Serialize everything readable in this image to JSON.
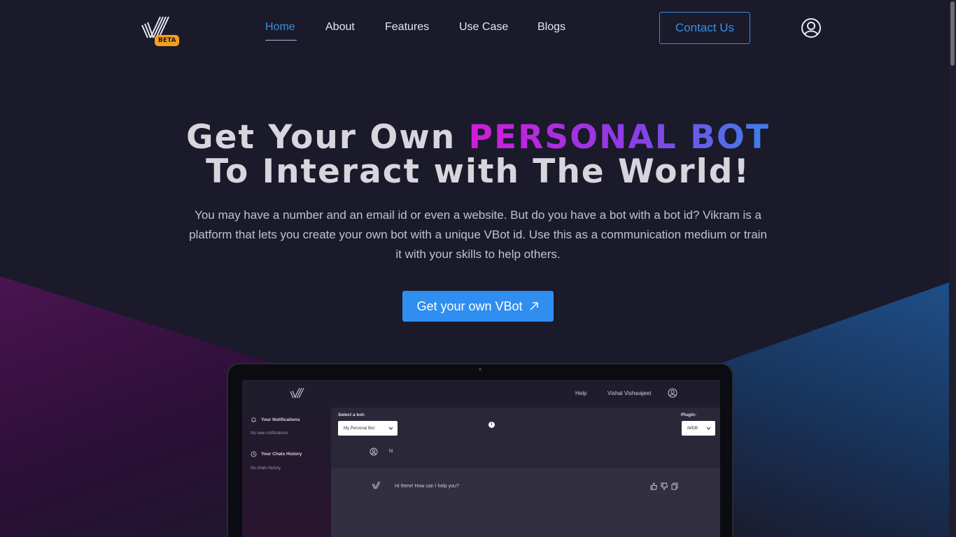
{
  "nav": {
    "beta": "BETA",
    "links": [
      "Home",
      "About",
      "Features",
      "Use Case",
      "Blogs"
    ],
    "active": "Home",
    "contact": "Contact Us"
  },
  "hero": {
    "title_line1_prefix": "Get Your Own ",
    "title_highlight": "PERSONAL BOT",
    "title_line2": "To Interact with The World!",
    "subtitle": "You may have a number and an email id or even a website. But do you have a bot with a bot id? Vikram is a platform that lets you create your own bot with a unique VBot id. Use this as a communication medium or train it with your skills to help others.",
    "cta": "Get your own VBot",
    "cta_icon": "arrow-up-right-icon"
  },
  "app_preview": {
    "header": {
      "help": "Help",
      "user": "Vishal Vishwajeet"
    },
    "sidebar": {
      "notifications_title": "Your Notifications",
      "notifications_empty": "No new notifications",
      "history_title": "Your Chats History",
      "history_empty": "No chats history"
    },
    "select_bot_label": "Select a bot:",
    "select_bot_value": "My Personal Bot",
    "plugin_label": "Plugin:",
    "plugin_value": "IMDB",
    "messages": [
      {
        "from": "user",
        "text": "hi"
      },
      {
        "from": "bot",
        "text": "Hi there! How can I help you?"
      }
    ]
  },
  "colors": {
    "accent": "#2f8ef0",
    "beta": "#f5a01a",
    "background": "#1a1a2b"
  }
}
